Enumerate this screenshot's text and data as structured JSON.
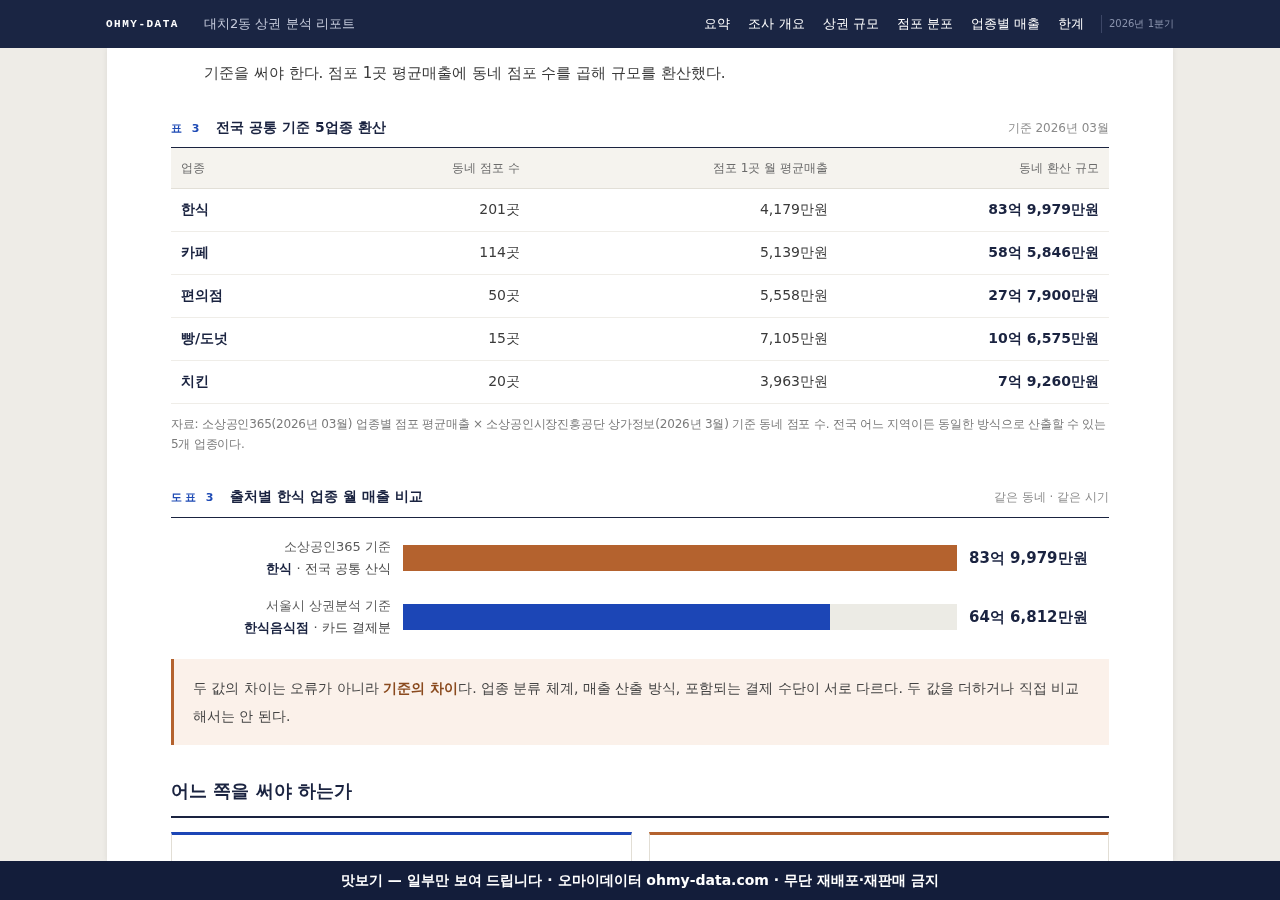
{
  "header": {
    "brand": "OHMY-DATA",
    "title": "대치2동 상권 분석 리포트",
    "nav": [
      "요약",
      "조사 개요",
      "상권 규모",
      "점포 분포",
      "업종별 매출",
      "한계"
    ],
    "period": "2026년 1분기"
  },
  "intro": "기준을 써야 한다. 점포 1곳 평균매출에 동네 점포 수를 곱해 규모를 환산했다.",
  "table": {
    "label": "표 3",
    "title": "전국 공통 기준 5업종 환산",
    "meta": "기준 2026년 03월",
    "columns": [
      "업종",
      "동네 점포 수",
      "점포 1곳 월 평균매출",
      "동네 환산 규모"
    ],
    "rows": [
      [
        "한식",
        "201곳",
        "4,179만원",
        "83억 9,979만원"
      ],
      [
        "카페",
        "114곳",
        "5,139만원",
        "58억 5,846만원"
      ],
      [
        "편의점",
        "50곳",
        "5,558만원",
        "27억 7,900만원"
      ],
      [
        "빵/도넛",
        "15곳",
        "7,105만원",
        "10억 6,575만원"
      ],
      [
        "치킨",
        "20곳",
        "3,963만원",
        "7억 9,260만원"
      ]
    ],
    "note": "자료: 소상공인365(2026년 03월) 업종별 점포 평균매출 × 소상공인시장진흥공단 상가정보(2026년 3월) 기준 동네 점포 수. 전국 어느 지역이든 동일한 방식으로 산출할 수 있는 5개 업종이다."
  },
  "figure": {
    "label": "도표 3",
    "title": "출처별 한식 업종 월 매출 비교",
    "meta": "같은 동네 · 같은 시기",
    "rows": [
      {
        "source": "소상공인365 기준",
        "scope": "**한식** · 전국 공통 산식",
        "level": 1,
        "reading": "83억 9,979만원",
        "color": "#b4622e"
      },
      {
        "source": "서울시 상권분석 기준",
        "scope": "**한식음식점** · 카드 결제분",
        "level": 0.77,
        "reading": "64억 6,812만원",
        "color": "#1c46b6"
      }
    ]
  },
  "callout": "두 값의 차이는 오류가 아니라 **기준의 차이**다. 업종 분류 체계, 매출 산출 방식, 포함되는 결제 수단이 서로 다르다. 두 값을 더하거나 직접 비교해서는 안 된다.",
  "section": {
    "heading": "어느 쪽을 써야 하는가",
    "cards": [
      {
        "color": "#1c46b6"
      },
      {
        "color": "#b4622e"
      }
    ]
  },
  "banner": "맛보기 — 일부만 보여 드립니다 · 오마이데이터 ohmy-data.com · 무단 재배포·재판매 금지"
}
